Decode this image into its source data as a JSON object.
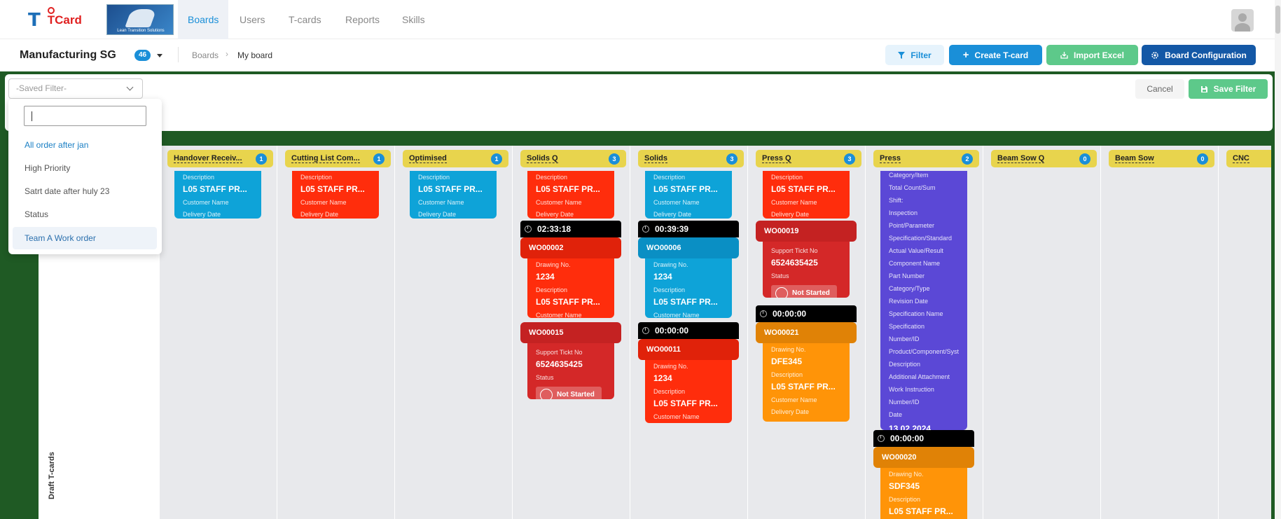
{
  "nav": {
    "logo_text": "TCard",
    "brand_caption": "Lean Transition Solutions",
    "tabs": [
      "Boards",
      "Users",
      "T-cards",
      "Reports",
      "Skills"
    ]
  },
  "header": {
    "board_title": "Manufacturing SG",
    "board_count": "46",
    "breadcrumb": [
      "Boards",
      "My board"
    ],
    "buttons": {
      "filter": "Filter",
      "create": "Create T-card",
      "import": "Import Excel",
      "config": "Board Configuration"
    }
  },
  "filter": {
    "placeholder": "-Saved Filter-",
    "cancel": "Cancel",
    "save": "Save Filter",
    "options": [
      "All order after jan",
      "High Priority",
      "Satrt date after huly 23",
      "Status",
      "Team A Work order"
    ]
  },
  "side_label": "Draft T-cards",
  "columns": [
    {
      "title": "Handover Receiv...",
      "count": "1"
    },
    {
      "title": "Cutting List Com...",
      "count": "1"
    },
    {
      "title": "Optimised",
      "count": "1"
    },
    {
      "title": "Solids Q",
      "count": "3"
    },
    {
      "title": "Solids",
      "count": "3"
    },
    {
      "title": "Press Q",
      "count": "3"
    },
    {
      "title": "Press",
      "count": "2"
    },
    {
      "title": "Beam Sow Q",
      "count": "0"
    },
    {
      "title": "Beam Sow",
      "count": "0"
    },
    {
      "title": "CNC",
      "count": ""
    }
  ],
  "labels": {
    "description": "Description",
    "customer": "Customer Name",
    "delivery": "Delivery Date",
    "drawing": "Drawing No.",
    "support": "Support Tickt No",
    "status": "Status",
    "not_started": "Not Started",
    "desc_value": "L05 STAFF PR..."
  },
  "cards": {
    "solidsq_timer": "02:33:18",
    "solidsq_id1": "WO00002",
    "solidsq_draw": "1234",
    "solidsq_id2": "WO00015",
    "solidsq_ticket": "6524635425",
    "solids_timer1": "00:39:39",
    "solids_id1": "WO00006",
    "solids_draw1": "1234",
    "solids_timer2": "00:00:00",
    "solids_id2": "WO00011",
    "solids_draw2": "1234",
    "pressq_id1": "WO00019",
    "pressq_ticket": "6524635425",
    "pressq_timer": "00:00:00",
    "pressq_id2": "WO00021",
    "pressq_draw": "DFE345",
    "press_fields": [
      "Category/Item",
      "Total Count/Sum",
      "Shift:",
      "Inspection",
      "Point/Parameter",
      "Specification/Standard",
      "Actual Value/Result",
      "Component Name",
      "Part Number",
      "Category/Type",
      "Revision Date",
      "Specification Name",
      "Specification",
      "Number/ID",
      "Product/Component/Syst",
      "Description",
      "Additional Attachment",
      "Work Instruction",
      "Number/ID",
      "Date"
    ],
    "press_date": "13.02.2024",
    "press_timer": "00:00:00",
    "press_id2": "WO00020",
    "press_draw": "SDF345"
  },
  "colors": {
    "primary": "#1a8fd8",
    "header_yellow": "#e8d44d",
    "card_blue": "#0ea3d8",
    "card_red": "#ff2d0c",
    "card_orange": "#ff9408",
    "card_purple": "#5b48d6",
    "board_green": "#1f5a24"
  }
}
